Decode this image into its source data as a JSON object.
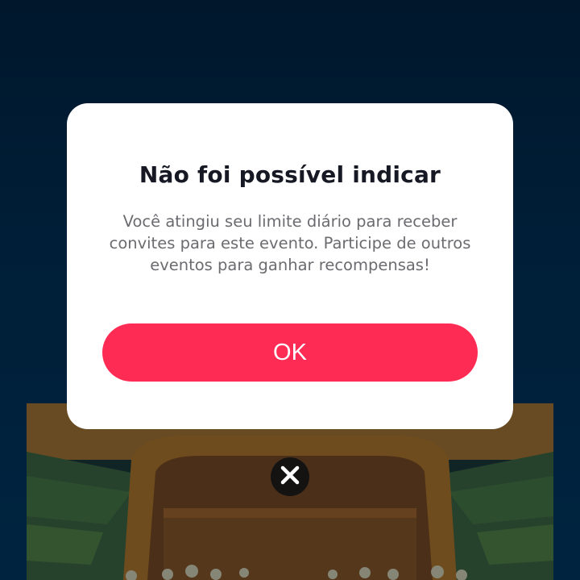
{
  "dialog": {
    "title": "Não foi possível indicar",
    "message": "Você atingiu seu limite diário para receber convites para este evento. Participe de outros eventos para ganhar recompensas!",
    "ok_label": "OK"
  },
  "close": {
    "icon": "close-icon"
  },
  "colors": {
    "backdrop": "#001a30",
    "dialog_bg": "#ffffff",
    "title": "#161823",
    "message": "#6b6b70",
    "primary_button": "#fe2c55",
    "close_button_bg": "#0a0e12"
  }
}
